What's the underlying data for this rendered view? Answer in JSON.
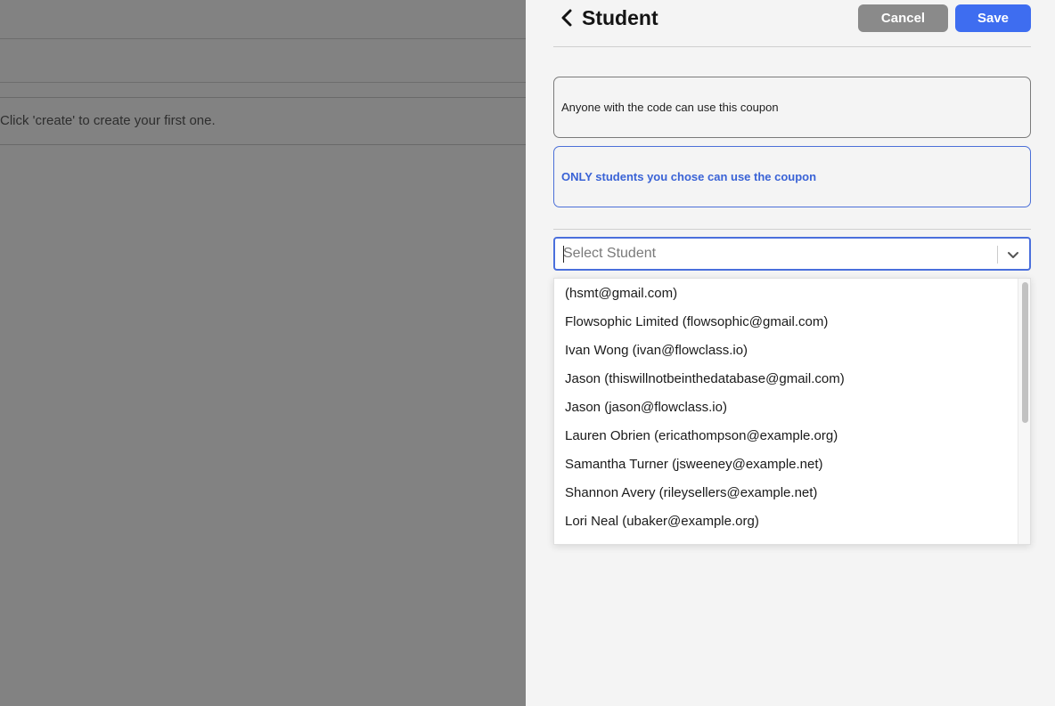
{
  "background": {
    "empty_message": "Click 'create' to create your first one."
  },
  "drawer": {
    "title": "Student",
    "cancel_label": "Cancel",
    "save_label": "Save",
    "option_anyone": "Anyone with the code can use this coupon",
    "option_only": "ONLY students you chose can use the coupon",
    "select_placeholder": "Select Student",
    "students": [
      "(hsmt@gmail.com)",
      "Flowsophic Limited (flowsophic@gmail.com)",
      "Ivan Wong (ivan@flowclass.io)",
      "Jason (thiswillnotbeinthedatabase@gmail.com)",
      "Jason (jason@flowclass.io)",
      "Lauren Obrien (ericathompson@example.org)",
      "Samantha Turner (jsweeney@example.net)",
      "Shannon Avery (rileysellers@example.net)",
      "Lori Neal (ubaker@example.org)"
    ]
  },
  "colors": {
    "accent": "#3e6df0",
    "cancel": "#8a8a8a",
    "selected_option": "#3a63d6"
  },
  "icons": {
    "back": "chevron-left-icon",
    "dropdown": "chevron-down-icon"
  }
}
